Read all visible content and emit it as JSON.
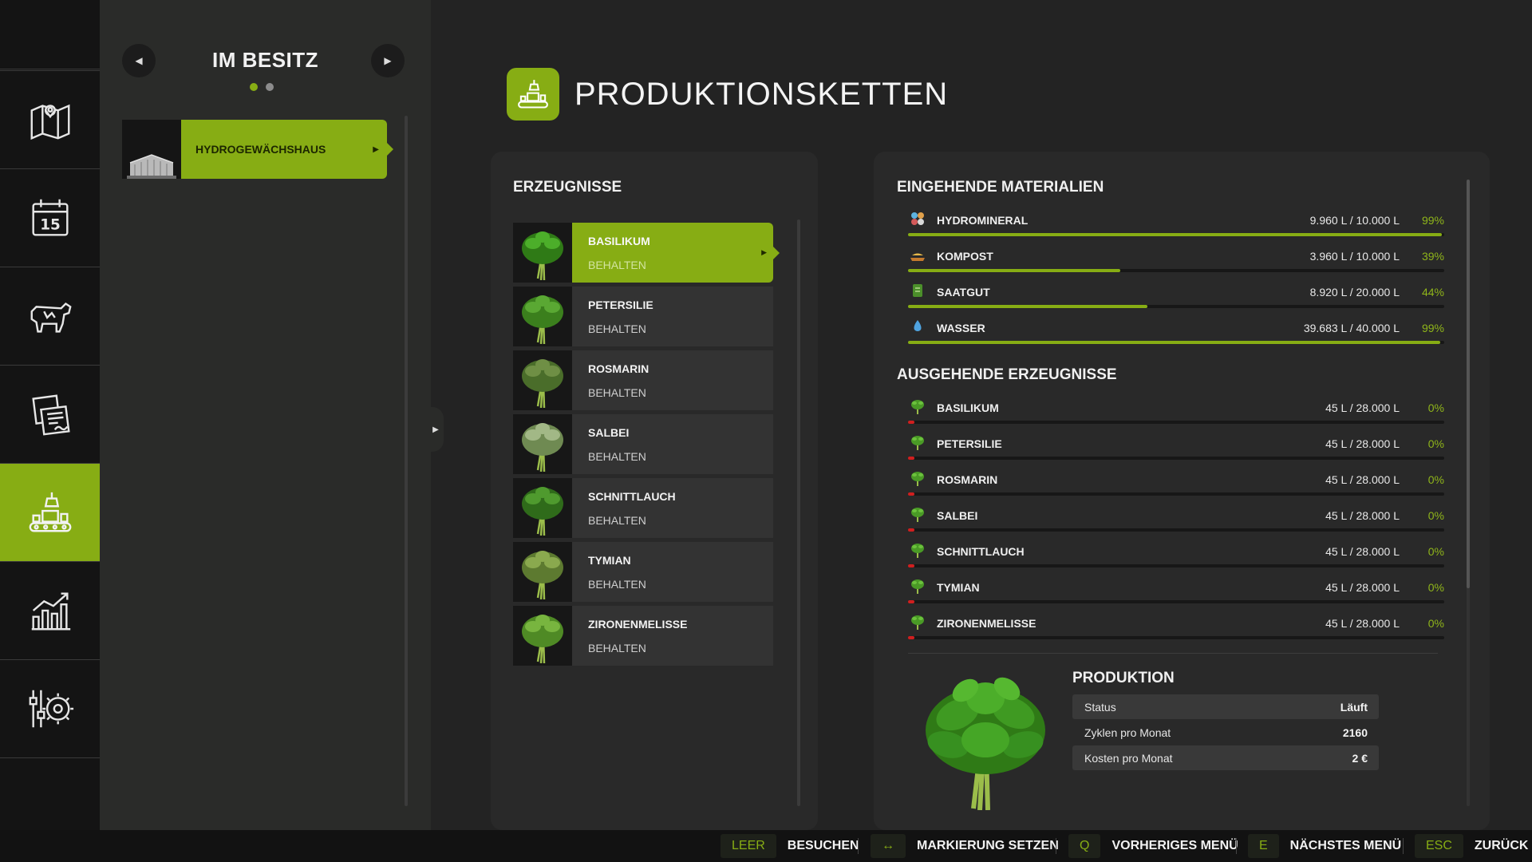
{
  "colors": {
    "accent": "#87ad14",
    "danger": "#d01f1f"
  },
  "sidebar": {
    "items": [
      {
        "icon": "map-icon"
      },
      {
        "icon": "calendar-icon",
        "badge": "15"
      },
      {
        "icon": "cow-icon"
      },
      {
        "icon": "contracts-icon"
      },
      {
        "icon": "production-icon",
        "active": true
      },
      {
        "icon": "statistics-icon"
      },
      {
        "icon": "settings-icon"
      }
    ]
  },
  "owned": {
    "title": "IM BESITZ",
    "page_dots": 2,
    "active_dot": 0,
    "items": [
      {
        "label": "HYDROGEWÄCHSHAUS"
      }
    ]
  },
  "header": {
    "title": "PRODUKTIONSKETTEN"
  },
  "products": {
    "title": "ERZEUGNISSE",
    "items": [
      {
        "name": "BASILIKUM",
        "status": "BEHALTEN",
        "active": true
      },
      {
        "name": "PETERSILIE",
        "status": "BEHALTEN"
      },
      {
        "name": "ROSMARIN",
        "status": "BEHALTEN"
      },
      {
        "name": "SALBEI",
        "status": "BEHALTEN"
      },
      {
        "name": "SCHNITTLAUCH",
        "status": "BEHALTEN"
      },
      {
        "name": "TYMIAN",
        "status": "BEHALTEN"
      },
      {
        "name": "ZIRONENMELISSE",
        "status": "BEHALTEN"
      }
    ]
  },
  "incoming": {
    "title": "EINGEHENDE MATERIALIEN",
    "items": [
      {
        "name": "HYDROMINERAL",
        "amount": "9.960 L / 10.000 L",
        "percent": "99%",
        "fill": 0.996
      },
      {
        "name": "KOMPOST",
        "amount": "3.960 L / 10.000 L",
        "percent": "39%",
        "fill": 0.396
      },
      {
        "name": "SAATGUT",
        "amount": "8.920 L / 20.000 L",
        "percent": "44%",
        "fill": 0.446
      },
      {
        "name": "WASSER",
        "amount": "39.683 L / 40.000 L",
        "percent": "99%",
        "fill": 0.992
      }
    ]
  },
  "outgoing": {
    "title": "AUSGEHENDE ERZEUGNISSE",
    "items": [
      {
        "name": "BASILIKUM",
        "amount": "45 L / 28.000 L",
        "percent": "0%",
        "fill": 0.002
      },
      {
        "name": "PETERSILIE",
        "amount": "45 L / 28.000 L",
        "percent": "0%",
        "fill": 0.002
      },
      {
        "name": "ROSMARIN",
        "amount": "45 L / 28.000 L",
        "percent": "0%",
        "fill": 0.002
      },
      {
        "name": "SALBEI",
        "amount": "45 L / 28.000 L",
        "percent": "0%",
        "fill": 0.002
      },
      {
        "name": "SCHNITTLAUCH",
        "amount": "45 L / 28.000 L",
        "percent": "0%",
        "fill": 0.002
      },
      {
        "name": "TYMIAN",
        "amount": "45 L / 28.000 L",
        "percent": "0%",
        "fill": 0.002
      },
      {
        "name": "ZIRONENMELISSE",
        "amount": "45 L / 28.000 L",
        "percent": "0%",
        "fill": 0.002
      }
    ]
  },
  "production": {
    "title": "PRODUKTION",
    "rows": [
      {
        "key": "Status",
        "value": "Läuft"
      },
      {
        "key": "Zyklen pro Monat",
        "value": "2160"
      },
      {
        "key": "Kosten pro Monat",
        "value": "2 €"
      }
    ]
  },
  "hints": [
    {
      "key": "LEER",
      "label": "BESUCHEN"
    },
    {
      "key": "↔",
      "label": "MARKIERUNG SETZEN"
    },
    {
      "key": "Q",
      "label": "VORHERIGES MENÜ"
    },
    {
      "key": "E",
      "label": "NÄCHSTES MENÜ"
    },
    {
      "key": "ESC",
      "label": "ZURÜCK"
    }
  ]
}
